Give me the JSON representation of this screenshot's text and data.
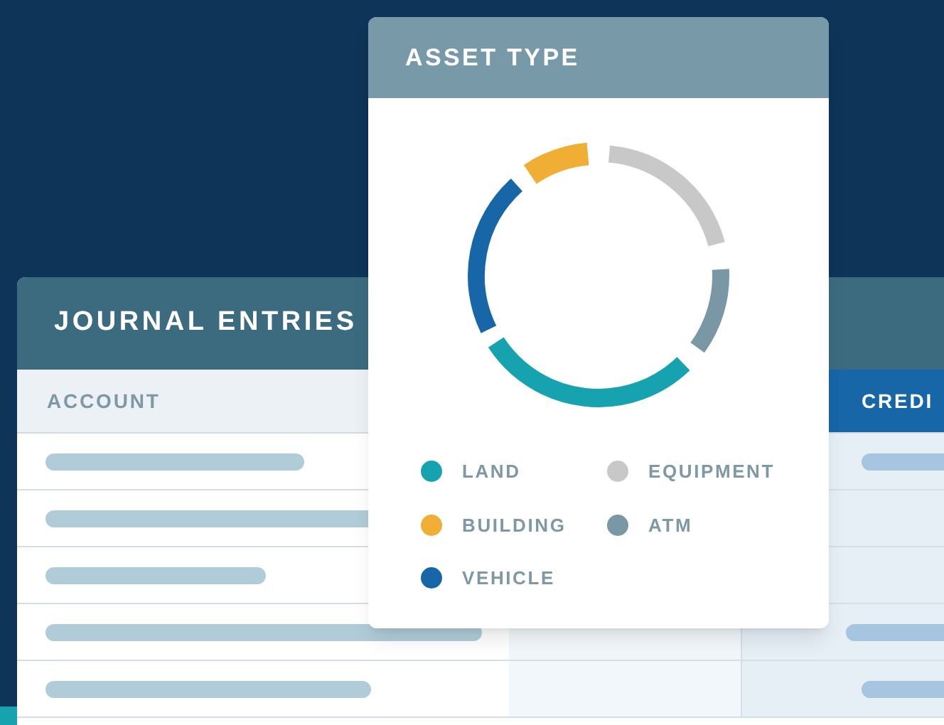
{
  "journal": {
    "title": "JOURNAL ENTRIES",
    "columns": [
      {
        "label": "ACCOUNT",
        "highlighted": false
      },
      {
        "label": "CREDI",
        "highlighted": true
      }
    ]
  },
  "asset_type": {
    "title": "ASSET TYPE",
    "legend": [
      {
        "label": "LAND",
        "color": "#17a2b0"
      },
      {
        "label": "EQUIPMENT",
        "color": "#c8c8c8"
      },
      {
        "label": "BUILDING",
        "color": "#f0ae35"
      },
      {
        "label": "ATM",
        "color": "#7a97a6"
      },
      {
        "label": "VEHICLE",
        "color": "#1767a8"
      }
    ]
  }
}
